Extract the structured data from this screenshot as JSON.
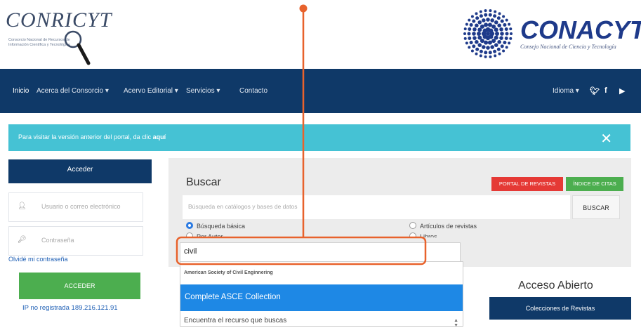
{
  "header": {
    "left_logo_text": "CONRICYT",
    "left_logo_sub": "Consorcio Nacional de Recursos de Información Científica y Tecnológica",
    "right_logo_text": "CONACYT",
    "right_logo_sub": "Consejo Nacional de Ciencia y Tecnología"
  },
  "nav": {
    "items": [
      "Inicio",
      "Acerca del Consorcio ▾",
      "Acervo Editorial ▾",
      "Servicios ▾",
      "Contacto"
    ],
    "idioma": "Idioma ▾",
    "social": [
      "twitter-icon",
      "facebook-icon",
      "youtube-icon"
    ]
  },
  "alert": {
    "text": "Para visitar la versión anterior del portal, da clic ",
    "link": "aquí",
    "close": "✕"
  },
  "login": {
    "title": "Acceder",
    "user_placeholder": "Usuario o correo electrónico",
    "password_placeholder": "Contraseña",
    "forgot": "Olvidé mi contraseña",
    "button": "ACCEDER",
    "ip": "IP no registrada 189.216.121.91"
  },
  "search": {
    "title": "Buscar",
    "portal_button": "PORTAL DE REVISTAS",
    "indice_button": "ÍNDICE DE CITAS",
    "placeholder": "Búsqueda en catálogos y bases de datos",
    "search_button": "BUSCAR",
    "radios": {
      "basic": "Búsqueda básica",
      "author": "Por Autor",
      "articles": "Artículos de revistas",
      "books": "Libros"
    },
    "typed_value": "civil",
    "dropdown": {
      "group": "American Society of Civil Enginnering",
      "selected": "Complete ASCE Collection",
      "bottom": "Encuentra el recurso que buscas"
    }
  },
  "right": {
    "acceso_title": "Acceso Abierto",
    "colecciones": "Colecciones de Revistas"
  }
}
